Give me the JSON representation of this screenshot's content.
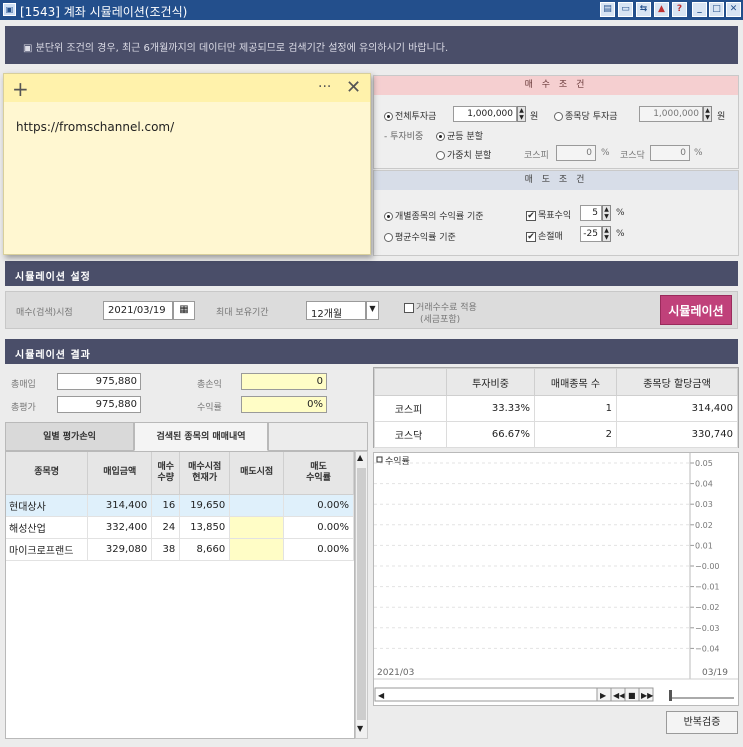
{
  "window": {
    "title": "[1543] 계좌 시뮬레이션(조건식)"
  },
  "notice": "▣ 분단위 조건의 경우, 최근 6개월까지의 데이터만 제공되므로 검색기간 설정에 유의하시기 바랍니다.",
  "sticky_note": {
    "text": "https://fromschannel.com/"
  },
  "buy_conditions": {
    "header": "매 수 조 건",
    "total_invest_label": "전체투자금",
    "total_invest_value": "1,000,000",
    "won": "원",
    "per_stock_label": "종목당 투자금",
    "per_stock_value": "1,000,000",
    "weight_label": "- 투자비중",
    "equal_label": "균등 분할",
    "weighted_label": "가중치 분할",
    "kospi_label": "코스피",
    "kospi_value": "0",
    "kosdaq_label": "코스닥",
    "kosdaq_value": "0",
    "pct": "%"
  },
  "sell_conditions": {
    "header": "매 도 조 건",
    "individual_label": "개별종목의 수익률 기준",
    "average_label": "평균수익률 기준",
    "target_label": "목표수익",
    "target_value": "5",
    "stoploss_label": "손절매",
    "stoploss_value": "-25",
    "pct": "%"
  },
  "sim_settings": {
    "section": "시뮬레이션 설정",
    "buy_date_label": "매수(검색)시점",
    "buy_date": "2021/03/19",
    "max_hold_label": "최대 보유기간",
    "max_hold": "12개월",
    "fee_label": "거래수수료 적용",
    "fee_sub": "(세금포함)",
    "run_button": "시뮬레이션"
  },
  "results": {
    "section": "시뮬레이션 결과",
    "total_buy_label": "총매입",
    "total_buy": "975,880",
    "total_eval_label": "총평가",
    "total_eval": "975,880",
    "total_pl_label": "총손익",
    "total_pl": "0",
    "return_label": "수익률",
    "return": "0%"
  },
  "tabs": [
    "일별 평가손익",
    "검색된 종목의 매매내역"
  ],
  "trade_table": {
    "headers": [
      "종목명",
      "매입금액",
      "매수\n수량",
      "매수시점\n현재가",
      "매도시점",
      "매도\n수익률"
    ],
    "rows": [
      [
        "현대상사",
        "314,400",
        "16",
        "19,650",
        "",
        "0.00%"
      ],
      [
        "해성산업",
        "332,400",
        "24",
        "13,850",
        "",
        "0.00%"
      ],
      [
        "마이크로프랜드",
        "329,080",
        "38",
        "8,660",
        "",
        "0.00%"
      ]
    ]
  },
  "alloc_table": {
    "headers": [
      "",
      "투자비중",
      "매매종목 수",
      "종목당 할당금액"
    ],
    "rows": [
      [
        "코스피",
        "33.33%",
        "1",
        "314,400"
      ],
      [
        "코스닥",
        "66.67%",
        "2",
        "330,740"
      ]
    ]
  },
  "chart_data": {
    "type": "line",
    "legend": "수익률",
    "y_ticks": [
      "0.05",
      "0.04",
      "0.03",
      "0.02",
      "0.01",
      "−0.00",
      "−0.01",
      "−0.02",
      "−0.03",
      "−0.04"
    ],
    "ylim": [
      -0.04,
      0.05
    ],
    "x_start": "2021/03",
    "x_end": "03/19",
    "series": []
  },
  "repeat_button": "반복검증",
  "colors": {
    "titlebar": "#234f8c",
    "section_bar": "#4a4e69",
    "sim_button": "#c0417a",
    "sticky_note": "#fff7d1"
  }
}
